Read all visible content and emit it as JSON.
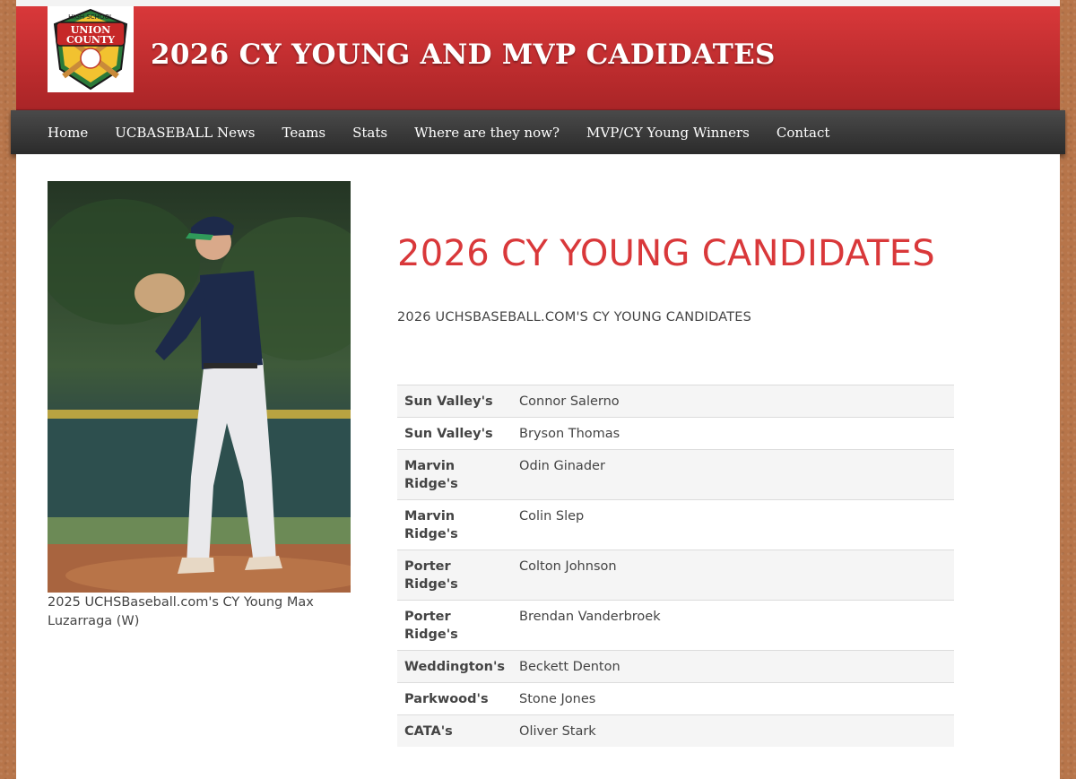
{
  "site": {
    "title": "2026 CY YOUNG AND MVP CADIDATES",
    "logo_text": {
      "top": "HIGH SCHOOL",
      "line1": "UNION",
      "line2": "COUNTY"
    }
  },
  "nav": {
    "items": [
      "Home",
      "UCBASEBALL News",
      "Teams",
      "Stats",
      "Where are they now?",
      "MVP/CY Young Winners",
      "Contact"
    ]
  },
  "photo": {
    "caption": "2025 UCHSBaseball.com's CY Young Max Luzarraga (W)"
  },
  "main": {
    "title": "2026 CY YOUNG CANDIDATES",
    "subtitle": "2026 UCHSBASEBALL.COM'S CY YOUNG CANDIDATES"
  },
  "candidates": [
    {
      "team": "Sun Valley's",
      "name": "Connor Salerno"
    },
    {
      "team": "Sun Valley's",
      "name": "Bryson Thomas"
    },
    {
      "team": "Marvin Ridge's",
      "name": "Odin Ginader"
    },
    {
      "team": "Marvin Ridge's",
      "name": "Colin Slep"
    },
    {
      "team": "Porter Ridge's",
      "name": "Colton Johnson"
    },
    {
      "team": "Porter Ridge's",
      "name": "Brendan Vanderbroek"
    },
    {
      "team": "Weddington's",
      "name": "Beckett Denton"
    },
    {
      "team": "Parkwood's",
      "name": "Stone Jones"
    },
    {
      "team": "CATA's",
      "name": "Oliver Stark"
    }
  ],
  "colors": {
    "header_red": "#d9383a",
    "title_red": "#d9383a",
    "nav_dark": "#333333"
  }
}
